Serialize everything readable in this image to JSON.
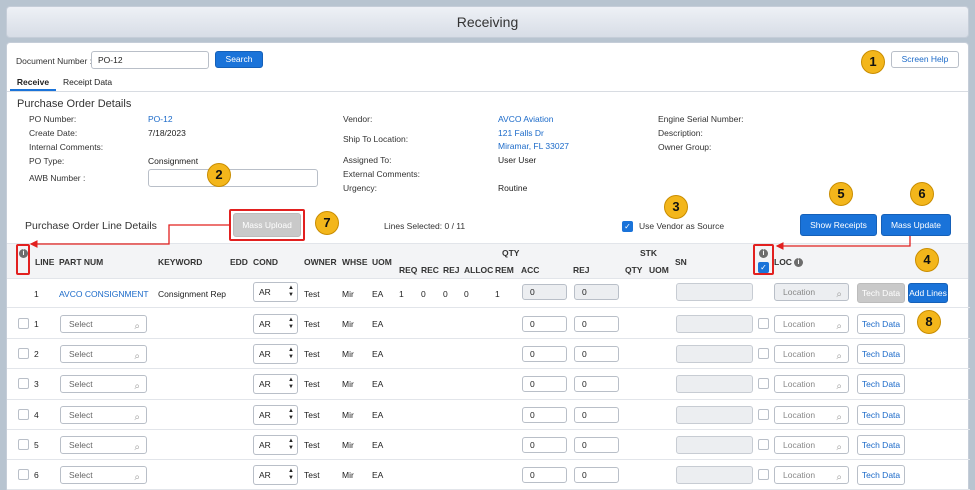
{
  "title": "Receiving",
  "doc": {
    "label": "Document Number :",
    "value": "PO-12",
    "search": "Search",
    "help": "Screen Help"
  },
  "tabs": [
    "Receive",
    "Receipt Data"
  ],
  "po": {
    "section": "Purchase Order Details",
    "left": [
      [
        "PO Number:",
        "PO-12"
      ],
      [
        "Create Date:",
        "7/18/2023"
      ],
      [
        "Internal Comments:",
        ""
      ],
      [
        "PO Type:",
        "Consignment"
      ],
      [
        "AWB Number :",
        ""
      ]
    ],
    "mid_labels": [
      "Vendor:",
      "Ship To Location:",
      "Assigned To:",
      "External Comments:",
      "Urgency:"
    ],
    "vendor": "AVCO Aviation",
    "ship1": "121 Falls Dr",
    "ship2": "Miramar, FL 33027",
    "assigned": "User User",
    "urgency": "Routine",
    "right": [
      "Engine Serial Number:",
      "Description:",
      "Owner Group:"
    ]
  },
  "lines": {
    "section": "Purchase Order Line Details",
    "mass_upload": "Mass Upload",
    "selected": "Lines Selected: 0 / 11",
    "vendor_src": "Use Vendor as Source",
    "show_receipts": "Show Receipts",
    "mass_update": "Mass Update"
  },
  "headers": {
    "line": "LINE",
    "part": "PART NUM",
    "keyword": "KEYWORD",
    "edd": "EDD",
    "cond": "COND",
    "owner": "OWNER",
    "whse": "WHSE",
    "uom": "UOM",
    "qty": "QTY",
    "req": "REQ",
    "rec": "REC",
    "rej": "REJ",
    "alloc": "ALLOC",
    "rem": "REM",
    "acc": "ACC",
    "rej2": "REJ",
    "stk": "STK",
    "stkqty": "QTY",
    "stkuom": "UOM",
    "sn": "SN",
    "loc": "LOC"
  },
  "first_row": {
    "line": "1",
    "part": "AVCO CONSIGNMENT",
    "keyword": "Consignment Rep",
    "cond": "AR",
    "owner": "Test",
    "whse": "Mir",
    "uom": "EA",
    "req": "1",
    "rec": "0",
    "rej": "0",
    "alloc": "0",
    "rem": "1",
    "acc": "0",
    "rej2": "0",
    "loc": "Location",
    "tech": "Tech Data",
    "add": "Add Lines"
  },
  "rows": [
    {
      "line": "1",
      "part": "Select",
      "cond": "AR",
      "owner": "Test",
      "whse": "Mir",
      "uom": "EA",
      "acc": "0",
      "rej": "0",
      "loc": "Location",
      "tech": "Tech Data"
    },
    {
      "line": "2",
      "part": "Select",
      "cond": "AR",
      "owner": "Test",
      "whse": "Mir",
      "uom": "EA",
      "acc": "0",
      "rej": "0",
      "loc": "Location",
      "tech": "Tech Data"
    },
    {
      "line": "3",
      "part": "Select",
      "cond": "AR",
      "owner": "Test",
      "whse": "Mir",
      "uom": "EA",
      "acc": "0",
      "rej": "0",
      "loc": "Location",
      "tech": "Tech Data"
    },
    {
      "line": "4",
      "part": "Select",
      "cond": "AR",
      "owner": "Test",
      "whse": "Mir",
      "uom": "EA",
      "acc": "0",
      "rej": "0",
      "loc": "Location",
      "tech": "Tech Data"
    },
    {
      "line": "5",
      "part": "Select",
      "cond": "AR",
      "owner": "Test",
      "whse": "Mir",
      "uom": "EA",
      "acc": "0",
      "rej": "0",
      "loc": "Location",
      "tech": "Tech Data"
    },
    {
      "line": "6",
      "part": "Select",
      "cond": "AR",
      "owner": "Test",
      "whse": "Mir",
      "uom": "EA",
      "acc": "0",
      "rej": "0",
      "loc": "Location",
      "tech": "Tech Data"
    }
  ],
  "badges": [
    "1",
    "2",
    "3",
    "4",
    "5",
    "6",
    "7",
    "8"
  ],
  "colors": {
    "accent": "#1a73d9",
    "badge": "#f3b61b",
    "callout": "#e2201f"
  }
}
